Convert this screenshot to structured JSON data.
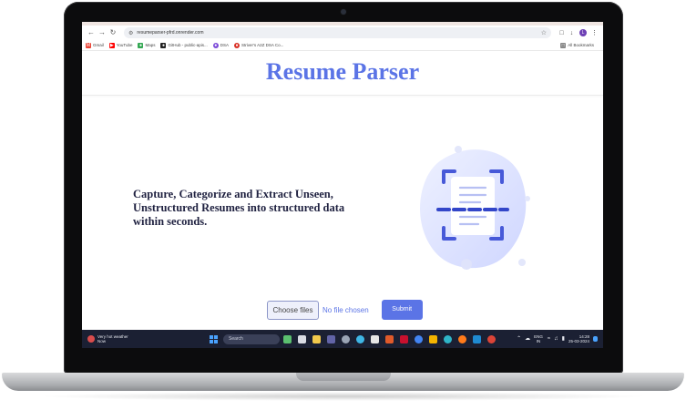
{
  "browser": {
    "url": "resumeparser-pfrd.onrender.com",
    "bookmarks": [
      {
        "label": "Gmail",
        "icon": "gmail-icon",
        "color": "#ea4335"
      },
      {
        "label": "YouTube",
        "icon": "youtube-icon",
        "color": "#ff0000"
      },
      {
        "label": "Maps",
        "icon": "maps-icon",
        "color": "#34a853"
      },
      {
        "label": "GitHub - public-apis...",
        "icon": "github-icon",
        "color": "#222222"
      },
      {
        "label": "DSA",
        "icon": "dsa-icon",
        "color": "#7b4ad8"
      },
      {
        "label": "Striver's A2Z DSA Co...",
        "icon": "striver-icon",
        "color": "#d93025"
      }
    ],
    "all_bookmarks": "All Bookmarks",
    "profile_initial": "L"
  },
  "page": {
    "title": "Resume Parser",
    "tagline": "Capture, Categorize and Extract Unseen, Unstructured Resumes into structured data within seconds.",
    "choose_files_label": "Choose files",
    "file_status": "No file chosen",
    "submit_label": "Submit",
    "accent": "#5b74e6"
  },
  "taskbar": {
    "weather_line1": "Very hot weather",
    "weather_line2": "Now",
    "search_placeholder": "Search",
    "lang_line1": "ENG",
    "lang_line2": "IN",
    "time": "14:28",
    "date": "25-03-2024"
  }
}
